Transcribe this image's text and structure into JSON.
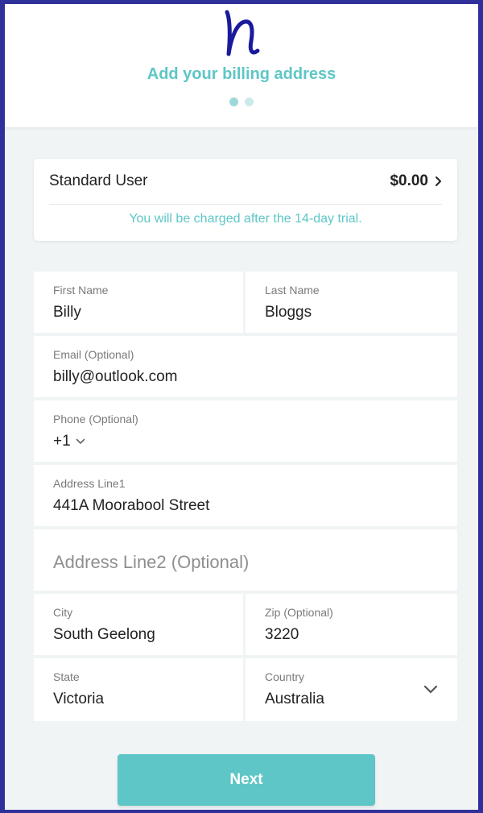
{
  "header": {
    "title": "Add your billing address",
    "steps": [
      {
        "active": true
      },
      {
        "active": false
      }
    ]
  },
  "plan": {
    "name": "Standard User",
    "price": "$0.00",
    "note": "You will be charged after the 14-day trial."
  },
  "form": {
    "first_name": {
      "label": "First Name",
      "value": "Billy"
    },
    "last_name": {
      "label": "Last Name",
      "value": "Bloggs"
    },
    "email": {
      "label": "Email (Optional)",
      "value": "billy@outlook.com"
    },
    "phone": {
      "label": "Phone (Optional)",
      "country_code": "+1"
    },
    "address1": {
      "label": "Address Line1",
      "value": "441A Moorabool Street"
    },
    "address2": {
      "placeholder": "Address Line2 (Optional)"
    },
    "city": {
      "label": "City",
      "value": "South Geelong"
    },
    "zip": {
      "label": "Zip (Optional)",
      "value": "3220"
    },
    "state": {
      "label": "State",
      "value": "Victoria"
    },
    "country": {
      "label": "Country",
      "value": "Australia"
    }
  },
  "next_button": {
    "label": "Next"
  },
  "colors": {
    "accent": "#5ec6c6",
    "dot_active": "#9fd8d8",
    "dot_inactive": "#cbeaea",
    "frame_border": "#30309a",
    "logo": "#1a1a9c"
  },
  "icons": {
    "logo": "script-n-logo",
    "plan_chevron": "chevron-right-icon",
    "phone_chevron": "chevron-down-icon",
    "country_chevron": "chevron-down-icon"
  }
}
